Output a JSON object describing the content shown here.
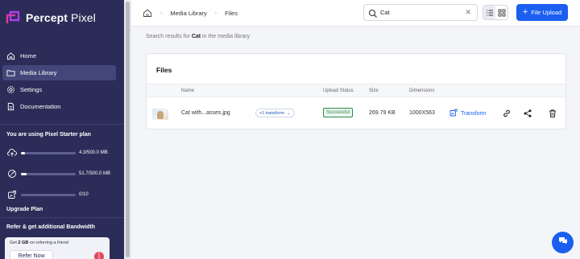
{
  "app": {
    "brand_bold": "Percept",
    "brand_light": " Pixel"
  },
  "sidebar": {
    "items": [
      {
        "label": "Home",
        "icon": "home-icon"
      },
      {
        "label": "Media Library",
        "icon": "folder-icon"
      },
      {
        "label": "Settings",
        "icon": "gear-icon"
      },
      {
        "label": "Documentation",
        "icon": "document-icon"
      }
    ],
    "active_index": 1,
    "plan": {
      "title": "You are using Pixel Starter plan",
      "usage": [
        {
          "icon": "upload-cloud-icon",
          "text": "4.3/500.0 MB",
          "fraction": 0.01
        },
        {
          "icon": "bandwidth-icon",
          "text": "51.7/500.0 MB",
          "fraction": 0.1
        },
        {
          "icon": "transform-icon",
          "text": "0/10",
          "fraction": 0.0
        }
      ],
      "upgrade_label": "Upgrade Plan"
    },
    "refer": {
      "title": "Refer & get additional Bandwidth",
      "text_prefix": "Get ",
      "text_bold": "2 GB",
      "text_suffix": " on referring a friend",
      "button": "Refer Now"
    }
  },
  "topbar": {
    "breadcrumbs": [
      "Media Library",
      "Files"
    ],
    "search_value": "Cat",
    "upload_label": "File Upload"
  },
  "main": {
    "search_info_prefix": "Search results for ",
    "search_term": "Cat",
    "search_info_suffix": " in the media library",
    "card_title": "Files",
    "columns": [
      "Name",
      "Upload Status",
      "Size",
      "Dimensions"
    ],
    "rows": [
      {
        "name": "Cat with...asses.jpg",
        "transform_dropdown": "+1 transform",
        "status": "Successful",
        "size": "269.79 KB",
        "dimensions": "1000X563",
        "transform_label": "Transform"
      }
    ]
  },
  "colors": {
    "sidebar": "#2b2c57",
    "accent": "#1a5ff0",
    "success": "#2e8a4a"
  }
}
